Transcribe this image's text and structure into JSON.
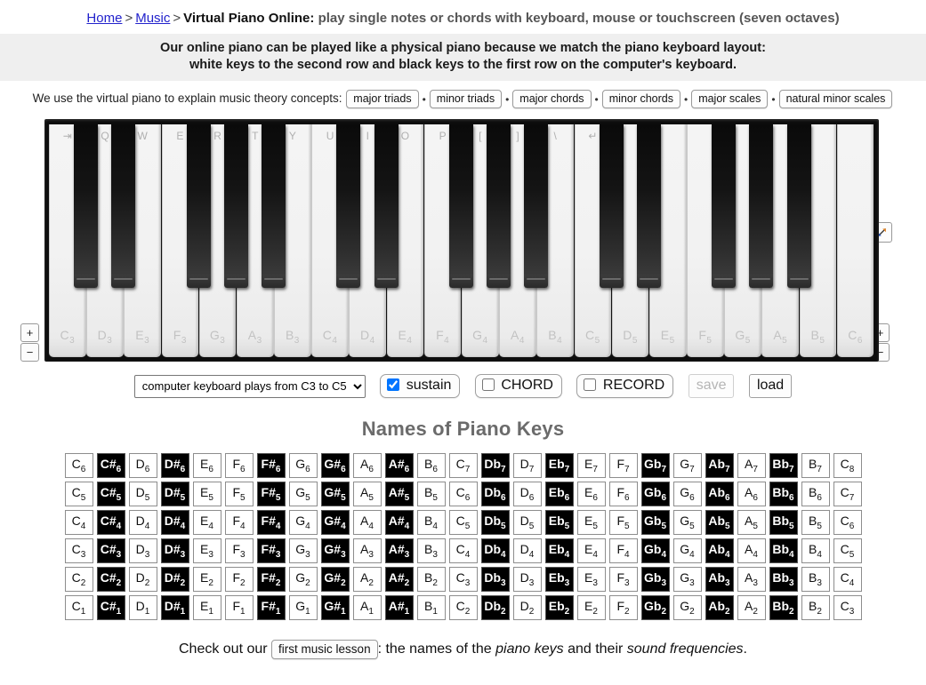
{
  "breadcrumb": {
    "home": "Home",
    "sep1": ">",
    "music": "Music",
    "sep2": ">",
    "page_title": "Virtual Piano Online:",
    "subtitle": "play single notes or chords with keyboard, mouse or touchscreen (seven octaves)"
  },
  "banner": {
    "line1": "Our online piano can be played like a physical piano because we match the piano keyboard layout:",
    "line2": "white keys to the second row and black keys to the first row on the computer's keyboard."
  },
  "theory": {
    "lead": "We use the virtual piano to explain music theory concepts:",
    "separator": "•",
    "links": [
      "major triads",
      "minor triads",
      "major chords",
      "minor chords",
      "major scales",
      "natural minor scales"
    ]
  },
  "piano": {
    "white_keys": [
      {
        "note": "C",
        "octave": "3",
        "kbd": "⇥"
      },
      {
        "note": "D",
        "octave": "3",
        "kbd": "Q"
      },
      {
        "note": "E",
        "octave": "3",
        "kbd": "W"
      },
      {
        "note": "F",
        "octave": "3",
        "kbd": "E"
      },
      {
        "note": "G",
        "octave": "3",
        "kbd": "R"
      },
      {
        "note": "A",
        "octave": "3",
        "kbd": "T"
      },
      {
        "note": "B",
        "octave": "3",
        "kbd": "Y"
      },
      {
        "note": "C",
        "octave": "4",
        "kbd": "U"
      },
      {
        "note": "D",
        "octave": "4",
        "kbd": "I"
      },
      {
        "note": "E",
        "octave": "4",
        "kbd": "O"
      },
      {
        "note": "F",
        "octave": "4",
        "kbd": "P"
      },
      {
        "note": "G",
        "octave": "4",
        "kbd": "["
      },
      {
        "note": "A",
        "octave": "4",
        "kbd": "]"
      },
      {
        "note": "B",
        "octave": "4",
        "kbd": "\\"
      },
      {
        "note": "C",
        "octave": "5",
        "kbd": "↵"
      },
      {
        "note": "D",
        "octave": "5",
        "kbd": ""
      },
      {
        "note": "E",
        "octave": "5",
        "kbd": ""
      },
      {
        "note": "F",
        "octave": "5",
        "kbd": ""
      },
      {
        "note": "G",
        "octave": "5",
        "kbd": ""
      },
      {
        "note": "A",
        "octave": "5",
        "kbd": ""
      },
      {
        "note": "B",
        "octave": "5",
        "kbd": ""
      },
      {
        "note": "C",
        "octave": "6",
        "kbd": ""
      }
    ],
    "black_keys": [
      {
        "after_white_index": 0,
        "kbd": ""
      },
      {
        "after_white_index": 1,
        "kbd": ""
      },
      {
        "after_white_index": 3,
        "kbd": ""
      },
      {
        "after_white_index": 4,
        "kbd": ""
      },
      {
        "after_white_index": 5,
        "kbd": ""
      },
      {
        "after_white_index": 7,
        "kbd": ""
      },
      {
        "after_white_index": 8,
        "kbd": ""
      },
      {
        "after_white_index": 10,
        "kbd": ""
      },
      {
        "after_white_index": 11,
        "kbd": ""
      },
      {
        "after_white_index": 12,
        "kbd": ""
      },
      {
        "after_white_index": 14,
        "kbd": ""
      },
      {
        "after_white_index": 15,
        "kbd": ""
      },
      {
        "after_white_index": 17,
        "kbd": ""
      },
      {
        "after_white_index": 18,
        "kbd": ""
      },
      {
        "after_white_index": 19,
        "kbd": ""
      }
    ],
    "left_plus": "+",
    "left_minus": "−",
    "right_plus": "+",
    "right_minus": "−",
    "expand_icon": "expand-arrows-icon"
  },
  "controls": {
    "keyboard_range_selected": "computer keyboard plays from C3 to C5",
    "keyboard_range_options": [
      "computer keyboard plays from C3 to C5"
    ],
    "sustain_label": "sustain",
    "sustain_checked": true,
    "chord_label": "CHORD",
    "chord_checked": false,
    "record_label": "RECORD",
    "record_checked": false,
    "save_label": "save",
    "save_disabled": true,
    "load_label": "load"
  },
  "names_section": {
    "title": "Names of Piano Keys",
    "columns": 24,
    "rows": [
      [
        {
          "n": "C",
          "o": "6",
          "b": false
        },
        {
          "n": "C#",
          "o": "6",
          "b": true
        },
        {
          "n": "D",
          "o": "6",
          "b": false
        },
        {
          "n": "D#",
          "o": "6",
          "b": true
        },
        {
          "n": "E",
          "o": "6",
          "b": false
        },
        {
          "n": "F",
          "o": "6",
          "b": false
        },
        {
          "n": "F#",
          "o": "6",
          "b": true
        },
        {
          "n": "G",
          "o": "6",
          "b": false
        },
        {
          "n": "G#",
          "o": "6",
          "b": true
        },
        {
          "n": "A",
          "o": "6",
          "b": false
        },
        {
          "n": "A#",
          "o": "6",
          "b": true
        },
        {
          "n": "B",
          "o": "6",
          "b": false
        },
        {
          "n": "C",
          "o": "7",
          "b": false
        },
        {
          "n": "Db",
          "o": "7",
          "b": true
        },
        {
          "n": "D",
          "o": "7",
          "b": false
        },
        {
          "n": "Eb",
          "o": "7",
          "b": true
        },
        {
          "n": "E",
          "o": "7",
          "b": false
        },
        {
          "n": "F",
          "o": "7",
          "b": false
        },
        {
          "n": "Gb",
          "o": "7",
          "b": true
        },
        {
          "n": "G",
          "o": "7",
          "b": false
        },
        {
          "n": "Ab",
          "o": "7",
          "b": true
        },
        {
          "n": "A",
          "o": "7",
          "b": false
        },
        {
          "n": "Bb",
          "o": "7",
          "b": true
        },
        {
          "n": "B",
          "o": "7",
          "b": false
        },
        {
          "n": "C",
          "o": "8",
          "b": false
        }
      ],
      [
        {
          "n": "C",
          "o": "5",
          "b": false
        },
        {
          "n": "C#",
          "o": "5",
          "b": true
        },
        {
          "n": "D",
          "o": "5",
          "b": false
        },
        {
          "n": "D#",
          "o": "5",
          "b": true
        },
        {
          "n": "E",
          "o": "5",
          "b": false
        },
        {
          "n": "F",
          "o": "5",
          "b": false
        },
        {
          "n": "F#",
          "o": "5",
          "b": true
        },
        {
          "n": "G",
          "o": "5",
          "b": false
        },
        {
          "n": "G#",
          "o": "5",
          "b": true
        },
        {
          "n": "A",
          "o": "5",
          "b": false
        },
        {
          "n": "A#",
          "o": "5",
          "b": true
        },
        {
          "n": "B",
          "o": "5",
          "b": false
        },
        {
          "n": "C",
          "o": "6",
          "b": false
        },
        {
          "n": "Db",
          "o": "6",
          "b": true
        },
        {
          "n": "D",
          "o": "6",
          "b": false
        },
        {
          "n": "Eb",
          "o": "6",
          "b": true
        },
        {
          "n": "E",
          "o": "6",
          "b": false
        },
        {
          "n": "F",
          "o": "6",
          "b": false
        },
        {
          "n": "Gb",
          "o": "6",
          "b": true
        },
        {
          "n": "G",
          "o": "6",
          "b": false
        },
        {
          "n": "Ab",
          "o": "6",
          "b": true
        },
        {
          "n": "A",
          "o": "6",
          "b": false
        },
        {
          "n": "Bb",
          "o": "6",
          "b": true
        },
        {
          "n": "B",
          "o": "6",
          "b": false
        },
        {
          "n": "C",
          "o": "7",
          "b": false
        }
      ],
      [
        {
          "n": "C",
          "o": "4",
          "b": false
        },
        {
          "n": "C#",
          "o": "4",
          "b": true
        },
        {
          "n": "D",
          "o": "4",
          "b": false
        },
        {
          "n": "D#",
          "o": "4",
          "b": true
        },
        {
          "n": "E",
          "o": "4",
          "b": false
        },
        {
          "n": "F",
          "o": "4",
          "b": false
        },
        {
          "n": "F#",
          "o": "4",
          "b": true
        },
        {
          "n": "G",
          "o": "4",
          "b": false
        },
        {
          "n": "G#",
          "o": "4",
          "b": true
        },
        {
          "n": "A",
          "o": "4",
          "b": false
        },
        {
          "n": "A#",
          "o": "4",
          "b": true
        },
        {
          "n": "B",
          "o": "4",
          "b": false
        },
        {
          "n": "C",
          "o": "5",
          "b": false
        },
        {
          "n": "Db",
          "o": "5",
          "b": true
        },
        {
          "n": "D",
          "o": "5",
          "b": false
        },
        {
          "n": "Eb",
          "o": "5",
          "b": true
        },
        {
          "n": "E",
          "o": "5",
          "b": false
        },
        {
          "n": "F",
          "o": "5",
          "b": false
        },
        {
          "n": "Gb",
          "o": "5",
          "b": true
        },
        {
          "n": "G",
          "o": "5",
          "b": false
        },
        {
          "n": "Ab",
          "o": "5",
          "b": true
        },
        {
          "n": "A",
          "o": "5",
          "b": false
        },
        {
          "n": "Bb",
          "o": "5",
          "b": true
        },
        {
          "n": "B",
          "o": "5",
          "b": false
        },
        {
          "n": "C",
          "o": "6",
          "b": false
        }
      ],
      [
        {
          "n": "C",
          "o": "3",
          "b": false
        },
        {
          "n": "C#",
          "o": "3",
          "b": true
        },
        {
          "n": "D",
          "o": "3",
          "b": false
        },
        {
          "n": "D#",
          "o": "3",
          "b": true
        },
        {
          "n": "E",
          "o": "3",
          "b": false
        },
        {
          "n": "F",
          "o": "3",
          "b": false
        },
        {
          "n": "F#",
          "o": "3",
          "b": true
        },
        {
          "n": "G",
          "o": "3",
          "b": false
        },
        {
          "n": "G#",
          "o": "3",
          "b": true
        },
        {
          "n": "A",
          "o": "3",
          "b": false
        },
        {
          "n": "A#",
          "o": "3",
          "b": true
        },
        {
          "n": "B",
          "o": "3",
          "b": false
        },
        {
          "n": "C",
          "o": "4",
          "b": false
        },
        {
          "n": "Db",
          "o": "4",
          "b": true
        },
        {
          "n": "D",
          "o": "4",
          "b": false
        },
        {
          "n": "Eb",
          "o": "4",
          "b": true
        },
        {
          "n": "E",
          "o": "4",
          "b": false
        },
        {
          "n": "F",
          "o": "4",
          "b": false
        },
        {
          "n": "Gb",
          "o": "4",
          "b": true
        },
        {
          "n": "G",
          "o": "4",
          "b": false
        },
        {
          "n": "Ab",
          "o": "4",
          "b": true
        },
        {
          "n": "A",
          "o": "4",
          "b": false
        },
        {
          "n": "Bb",
          "o": "4",
          "b": true
        },
        {
          "n": "B",
          "o": "4",
          "b": false
        },
        {
          "n": "C",
          "o": "5",
          "b": false
        }
      ],
      [
        {
          "n": "C",
          "o": "2",
          "b": false
        },
        {
          "n": "C#",
          "o": "2",
          "b": true
        },
        {
          "n": "D",
          "o": "2",
          "b": false
        },
        {
          "n": "D#",
          "o": "2",
          "b": true
        },
        {
          "n": "E",
          "o": "2",
          "b": false
        },
        {
          "n": "F",
          "o": "2",
          "b": false
        },
        {
          "n": "F#",
          "o": "2",
          "b": true
        },
        {
          "n": "G",
          "o": "2",
          "b": false
        },
        {
          "n": "G#",
          "o": "2",
          "b": true
        },
        {
          "n": "A",
          "o": "2",
          "b": false
        },
        {
          "n": "A#",
          "o": "2",
          "b": true
        },
        {
          "n": "B",
          "o": "2",
          "b": false
        },
        {
          "n": "C",
          "o": "3",
          "b": false
        },
        {
          "n": "Db",
          "o": "3",
          "b": true
        },
        {
          "n": "D",
          "o": "3",
          "b": false
        },
        {
          "n": "Eb",
          "o": "3",
          "b": true
        },
        {
          "n": "E",
          "o": "3",
          "b": false
        },
        {
          "n": "F",
          "o": "3",
          "b": false
        },
        {
          "n": "Gb",
          "o": "3",
          "b": true
        },
        {
          "n": "G",
          "o": "3",
          "b": false
        },
        {
          "n": "Ab",
          "o": "3",
          "b": true
        },
        {
          "n": "A",
          "o": "3",
          "b": false
        },
        {
          "n": "Bb",
          "o": "3",
          "b": true
        },
        {
          "n": "B",
          "o": "3",
          "b": false
        },
        {
          "n": "C",
          "o": "4",
          "b": false
        }
      ],
      [
        {
          "n": "C",
          "o": "1",
          "b": false
        },
        {
          "n": "C#",
          "o": "1",
          "b": true
        },
        {
          "n": "D",
          "o": "1",
          "b": false
        },
        {
          "n": "D#",
          "o": "1",
          "b": true
        },
        {
          "n": "E",
          "o": "1",
          "b": false
        },
        {
          "n": "F",
          "o": "1",
          "b": false
        },
        {
          "n": "F#",
          "o": "1",
          "b": true
        },
        {
          "n": "G",
          "o": "1",
          "b": false
        },
        {
          "n": "G#",
          "o": "1",
          "b": true
        },
        {
          "n": "A",
          "o": "1",
          "b": false
        },
        {
          "n": "A#",
          "o": "1",
          "b": true
        },
        {
          "n": "B",
          "o": "1",
          "b": false
        },
        {
          "n": "C",
          "o": "2",
          "b": false
        },
        {
          "n": "Db",
          "o": "2",
          "b": true
        },
        {
          "n": "D",
          "o": "2",
          "b": false
        },
        {
          "n": "Eb",
          "o": "2",
          "b": true
        },
        {
          "n": "E",
          "o": "2",
          "b": false
        },
        {
          "n": "F",
          "o": "2",
          "b": false
        },
        {
          "n": "Gb",
          "o": "2",
          "b": true
        },
        {
          "n": "G",
          "o": "2",
          "b": false
        },
        {
          "n": "Ab",
          "o": "2",
          "b": true
        },
        {
          "n": "A",
          "o": "2",
          "b": false
        },
        {
          "n": "Bb",
          "o": "2",
          "b": true
        },
        {
          "n": "B",
          "o": "2",
          "b": false
        },
        {
          "n": "C",
          "o": "3",
          "b": false
        }
      ]
    ]
  },
  "footer": {
    "prefix": "Check out our",
    "lesson_label": "first music lesson",
    "mid": ": the names of the",
    "em1": "piano keys",
    "mid2": "and their",
    "em2": "sound frequencies",
    "end": "."
  },
  "colors": {
    "link": "#2222cc",
    "banner_bg": "#efefef",
    "heading_gray": "#6b6b6b",
    "checkbox_accent": "#1a73e8",
    "black_key": "#000000"
  }
}
